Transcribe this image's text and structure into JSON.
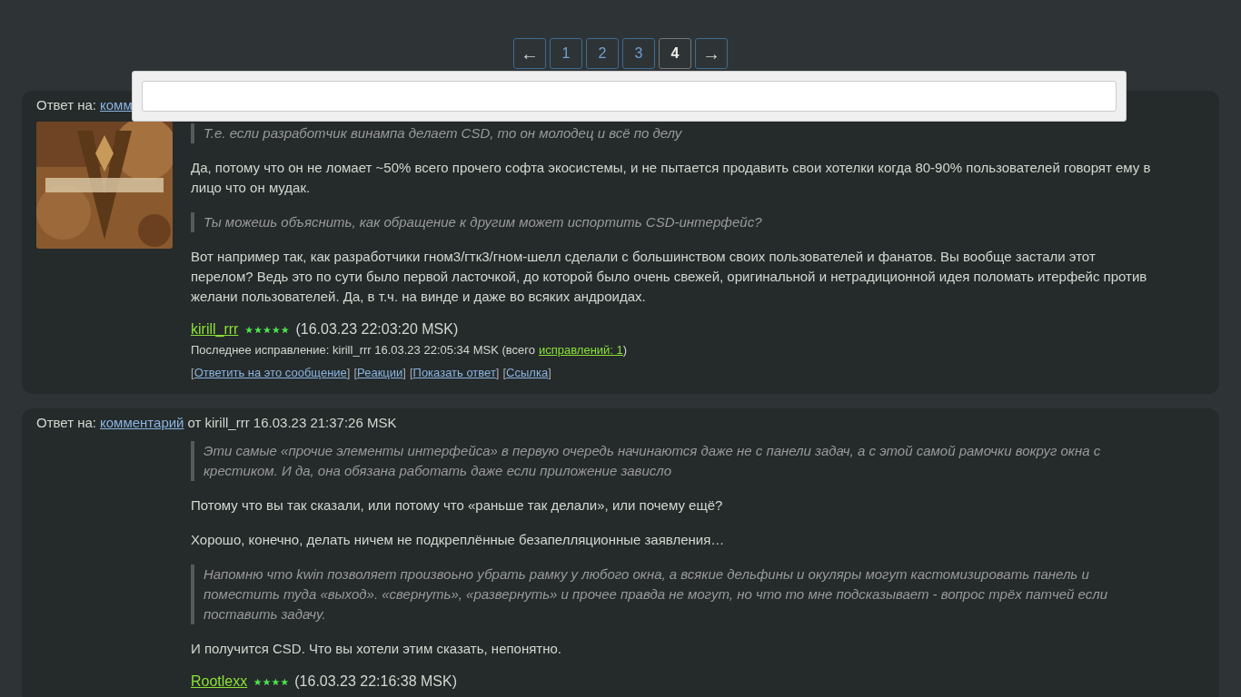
{
  "pagination": [
    {
      "label": "←",
      "kind": "prev",
      "selected": false
    },
    {
      "label": "1",
      "kind": "page",
      "selected": false
    },
    {
      "label": "2",
      "kind": "page",
      "selected": false
    },
    {
      "label": "3",
      "kind": "page",
      "selected": false
    },
    {
      "label": "4",
      "kind": "page",
      "selected": true
    },
    {
      "label": "→",
      "kind": "next",
      "selected": false
    }
  ],
  "popup": {
    "kind": "search"
  },
  "comments": [
    {
      "header": {
        "prefix": "Ответ на:",
        "link": "комм"
      },
      "avatar": {
        "kind": "picture"
      },
      "blocks": [
        {
          "kind": "quote",
          "text": "Т.е. если разработчик винампа делает CSD, то он молодец и всё по делу"
        },
        {
          "kind": "para",
          "text": "Да, потому что он не ломает ~50% всего прочего софта экосистемы, и не пытается продавить свои хотелки когда 80-90% пользователей говорят ему в лицо что он мудак."
        },
        {
          "kind": "quote",
          "text": "Ты можешь объяснить, как обращение к другим может испортить CSD-интерфейс?"
        },
        {
          "kind": "para",
          "text": "Вот например так, как разработчики гном3/гтк3/гном-шелл сделали с большинством своих пользователей и фанатов. Вы вообще застали этот перелом? Ведь это по сути было первой ласточкой, до которой было очень свежей, оригинальной и нетрадиционной идея поломать итерфейс против желани пользователей. Да, в т.ч. на винде и даже во всяких андроидах."
        }
      ],
      "author": "kirill_rrr",
      "stars": 5,
      "time": "(16.03.23 22:03:20 MSK)",
      "edit": {
        "text": "Последнее исправление: kirill_rrr 16.03.23 22:05:34 MSK (всего",
        "link": "исправлений: 1",
        "close": ")"
      },
      "actions": [
        {
          "open": "[",
          "label": "Ответить на это сообщение",
          "close": "]"
        },
        {
          "open": "[",
          "label": "Реакции",
          "close": "]"
        },
        {
          "open": "[",
          "label": "Показать ответ",
          "close": "]"
        },
        {
          "open": "[",
          "label": "Ссылка",
          "close": "]"
        }
      ]
    },
    {
      "header": {
        "prefix": "Ответ на:",
        "link": "комментарий",
        "suffix": "от kirill_rrr 16.03.23 21:37:26 MSK"
      },
      "blocks": [
        {
          "kind": "quote",
          "text": "Эти самые «прочие элементы интерфейса» в первую очередь начинаются даже не с панели задач, а с этой самой рамочки вокруг окна с крестиком. И да, она обязана работать даже если приложение зависло"
        },
        {
          "kind": "para",
          "text": "Потому что вы так сказали, или потому что «раньше так делали», или почему ещё?"
        },
        {
          "kind": "para",
          "text": "Хорошо, конечно, делать ничем не подкреплённые безапелляционные заявления…"
        },
        {
          "kind": "quote",
          "text": "Напомню что kwin позволяет произвоьно убрать рамку у любого окна, а всякие дельфины и окуляры могут кастомизировать панель и поместить туда «выход». «свернуть», «развернуть» и прочее правда не могут, но что то мне подсказывает - вопрос трёх патчей если поставить задачу."
        },
        {
          "kind": "para",
          "text": "И получится CSD. Что вы хотели этим сказать, непонятно."
        }
      ],
      "author": "Rootlexx",
      "stars": 4,
      "time": "(16.03.23 22:16:38 MSK)"
    }
  ]
}
